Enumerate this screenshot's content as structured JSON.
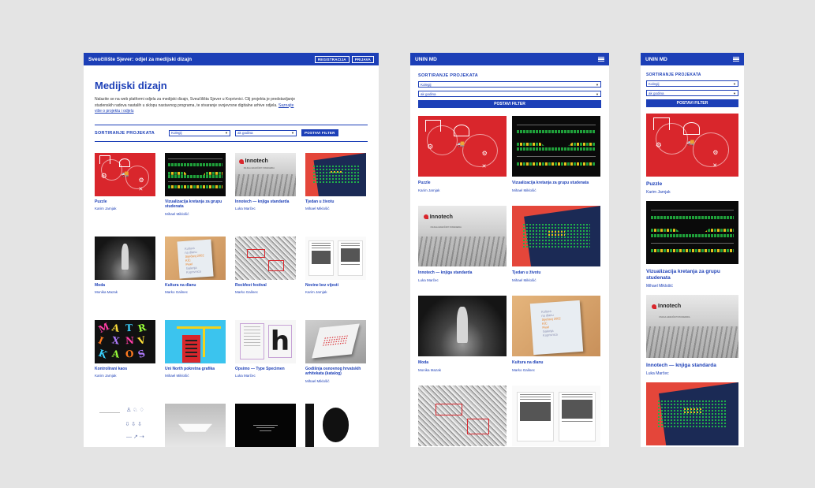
{
  "desktop": {
    "brand": "Sveučilište Sjever: odjel za medijski dizajn",
    "register_label": "REGISTRACIJA",
    "login_label": "PRIJAVA",
    "title": "Medijski dizajn",
    "intro": "Nalazite se na web platformi odjela za medijski dizajn, Sveučilišta Sjever u Koprivnici. Cilj projekta je predstavljanje studenskih radova nastalih u sklopu nastavnog programa, te stvaranje svojevrsne digitalne arhive odjela.",
    "intro_link": "Saznajte više o projektu i odjelu",
    "filter_label": "SORTIRANJE PROJEKATA",
    "course_select": "Kolegij",
    "year_select": "ak godina",
    "filter_button": "POSTAVI FILTER",
    "projects": [
      {
        "title": "Puzzle",
        "author": "Karim Jarnjak",
        "thumb": "puzzle"
      },
      {
        "title": "Vizualizacija kretanja za grupu studenata",
        "author": "Mihael Miklošić",
        "thumb": "viz"
      },
      {
        "title": "Innotech — knjiga standarda",
        "author": "Luka Marčec",
        "thumb": "inno"
      },
      {
        "title": "Tjedan u životu",
        "author": "Mihael Miklošić",
        "thumb": "tjed"
      },
      {
        "title": "Moda",
        "author": "Monika Mazak",
        "thumb": "moda"
      },
      {
        "title": "Kultura na dlanu",
        "author": "Marko Galinec",
        "thumb": "kult"
      },
      {
        "title": "Rockfest festival",
        "author": "Marko Galinec",
        "thumb": "roc"
      },
      {
        "title": "Novine bez vijesti",
        "author": "Karim Jarnjak",
        "thumb": "nov"
      },
      {
        "title": "Kontrolirani kaos",
        "author": "Karim Jarnjak",
        "thumb": "kon"
      },
      {
        "title": "Uni North pokretna grafika",
        "author": "Mihael Miklošić",
        "thumb": "uni"
      },
      {
        "title": "Opsimo — Type Specimen",
        "author": "Luka Marčec",
        "thumb": "ops"
      },
      {
        "title": "Godišnja osnovnog hrvatskih arhitekata (katalog)",
        "author": "Mihael Miklošić",
        "thumb": "god"
      },
      {
        "title": "",
        "author": "",
        "thumb": "pict"
      },
      {
        "title": "",
        "author": "",
        "thumb": "boat"
      },
      {
        "title": "",
        "author": "",
        "thumb": "night"
      },
      {
        "title": "",
        "author": "",
        "thumb": "circ"
      }
    ]
  },
  "tablet": {
    "brand": "UNIN MD",
    "filter_label": "SORTIRANJE PROJEKATA",
    "course_select": "Kolegij",
    "year_select": "ak godina",
    "filter_button": "POSTAVI FILTER",
    "projects": [
      {
        "title": "Puzzle",
        "author": "Karim Jarnjak",
        "thumb": "puzzle"
      },
      {
        "title": "Vizualizacija kretanja za grupu studenata",
        "author": "Mihael Miklošić",
        "thumb": "viz"
      },
      {
        "title": "Innotech — knjiga standarda",
        "author": "Luka Marčec",
        "thumb": "inno"
      },
      {
        "title": "Tjedan u životu",
        "author": "Mihael Miklošić",
        "thumb": "tjed"
      },
      {
        "title": "Moda",
        "author": "Monika Mazak",
        "thumb": "moda"
      },
      {
        "title": "Kultura na dlanu",
        "author": "Marko Galinec",
        "thumb": "kult"
      },
      {
        "title": "",
        "author": "",
        "thumb": "roc"
      },
      {
        "title": "",
        "author": "",
        "thumb": "nov"
      }
    ]
  },
  "mobile": {
    "brand": "UNIN MD",
    "filter_label": "SORTIRANJE PROJEKATA",
    "course_select": "Kolegij",
    "year_select": "ak godina",
    "filter_button": "POSTAVI FILTER",
    "projects": [
      {
        "title": "Puzzle",
        "author": "Karim Jarnjak",
        "thumb": "puzzle"
      },
      {
        "title": "Vizualizacija kretanja za grupu studenata",
        "author": "Mihael Miklošić",
        "thumb": "viz"
      },
      {
        "title": "Innotech — knjiga standarda",
        "author": "Luka Marčec",
        "thumb": "inno"
      },
      {
        "title": "",
        "author": "",
        "thumb": "tjed"
      }
    ]
  },
  "thumb_text": {
    "innotech_logo": "Innotech",
    "innotech_sub": "KNJIGA GRAFIČKIH STANDARDA",
    "kultura_lines": [
      "Kultura",
      "na dlanu"
    ],
    "kultura_year": "Siječanj 2002",
    "kultura_venue": [
      "KIC",
      "Pixel",
      "Galerija",
      "Koprivnica"
    ],
    "ops_letter": "h",
    "kaos_letters": [
      "M",
      "A",
      "T",
      "R",
      "I",
      "X",
      "N",
      "V",
      "K",
      "A",
      "O",
      "S"
    ]
  },
  "colors": {
    "brand_blue": "#1c3fb7",
    "accent_red": "#d9262c",
    "background": "#e4e4e4"
  },
  "icons": {
    "menu": "hamburger-menu-icon",
    "select_caret": "chevron-down-icon"
  }
}
